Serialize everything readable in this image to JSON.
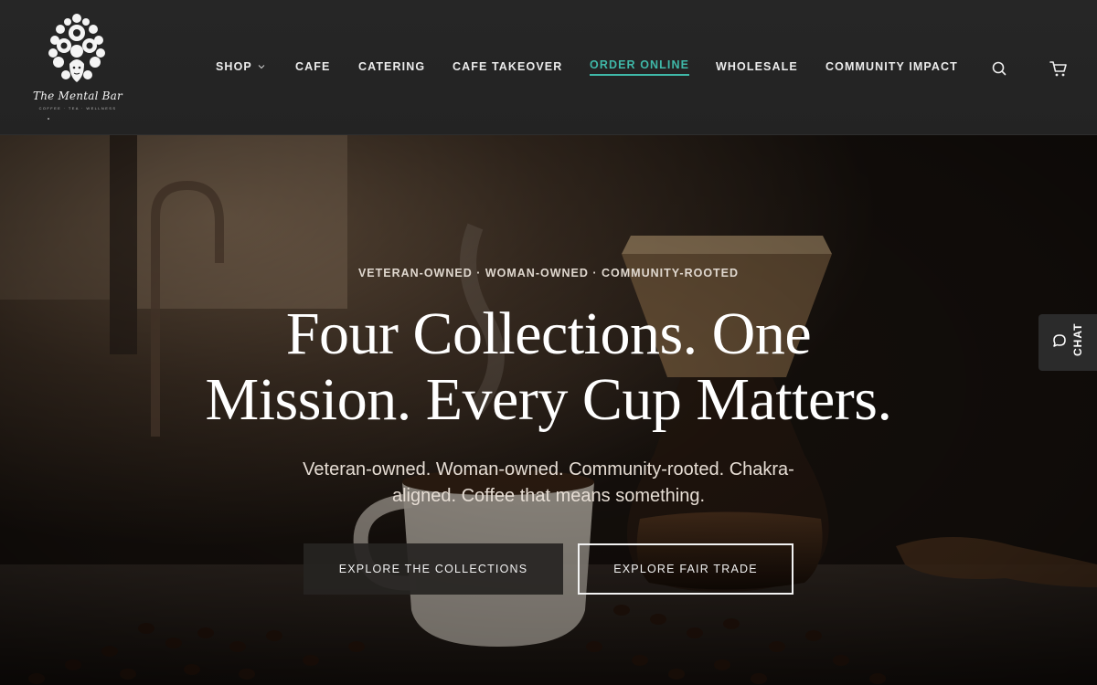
{
  "brand": {
    "name": "The Mental Bar",
    "tagline": "COFFEE · TEA · WELLNESS"
  },
  "nav": {
    "items": [
      {
        "label": "SHOP",
        "has_dropdown": true
      },
      {
        "label": "CAFE"
      },
      {
        "label": "CATERING"
      },
      {
        "label": "CAFE TAKEOVER"
      },
      {
        "label": "ORDER ONLINE",
        "active": true
      },
      {
        "label": "WHOLESALE"
      },
      {
        "label": "COMMUNITY IMPACT"
      }
    ],
    "icons": [
      "search-icon",
      "cart-icon"
    ]
  },
  "hero": {
    "eyebrow": "VETERAN-OWNED · WOMAN-OWNED · COMMUNITY-ROOTED",
    "headline_line1": "Four Collections. One",
    "headline_line2": "Mission. Every Cup Matters.",
    "subhead": "Veteran-owned. Woman-owned. Community-rooted. Chakra-aligned. Coffee that means something.",
    "primary_button": "EXPLORE THE COLLECTIONS",
    "secondary_button": "EXPLORE FAIR TRADE"
  },
  "chat": {
    "label": "CHAT"
  },
  "colors": {
    "header_bg": "#242424",
    "accent": "#3fb8a8",
    "text_light": "#ececec"
  }
}
